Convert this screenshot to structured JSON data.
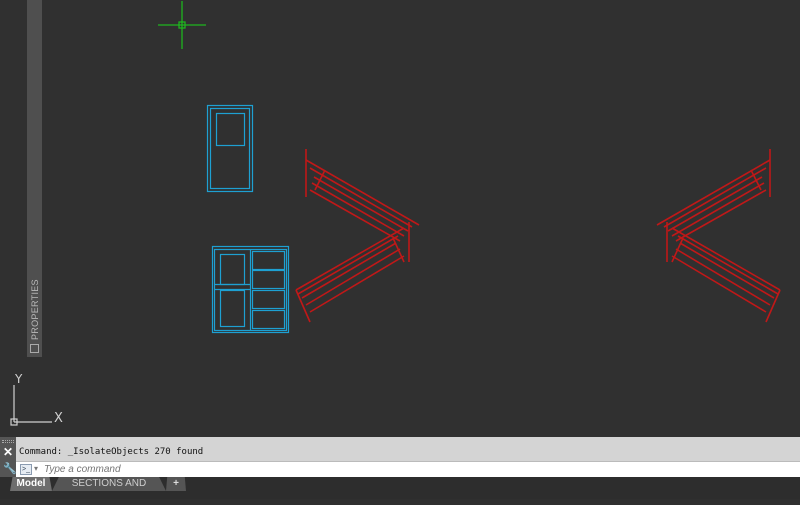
{
  "palette": {
    "label": "PROPERTIES"
  },
  "ucs": {
    "x_label": "X",
    "y_label": "Y"
  },
  "command": {
    "history": "Command:  _IsolateObjects 270 found",
    "placeholder": "Type a command",
    "prompt_icon": ">_"
  },
  "tabs": [
    {
      "label": "Model"
    },
    {
      "label": "SECTIONS AND DETAILS"
    },
    {
      "label": "+"
    }
  ],
  "colors": {
    "door": "#1ea0d2",
    "stair": "#c01818",
    "cursor": "#1fb51f"
  }
}
